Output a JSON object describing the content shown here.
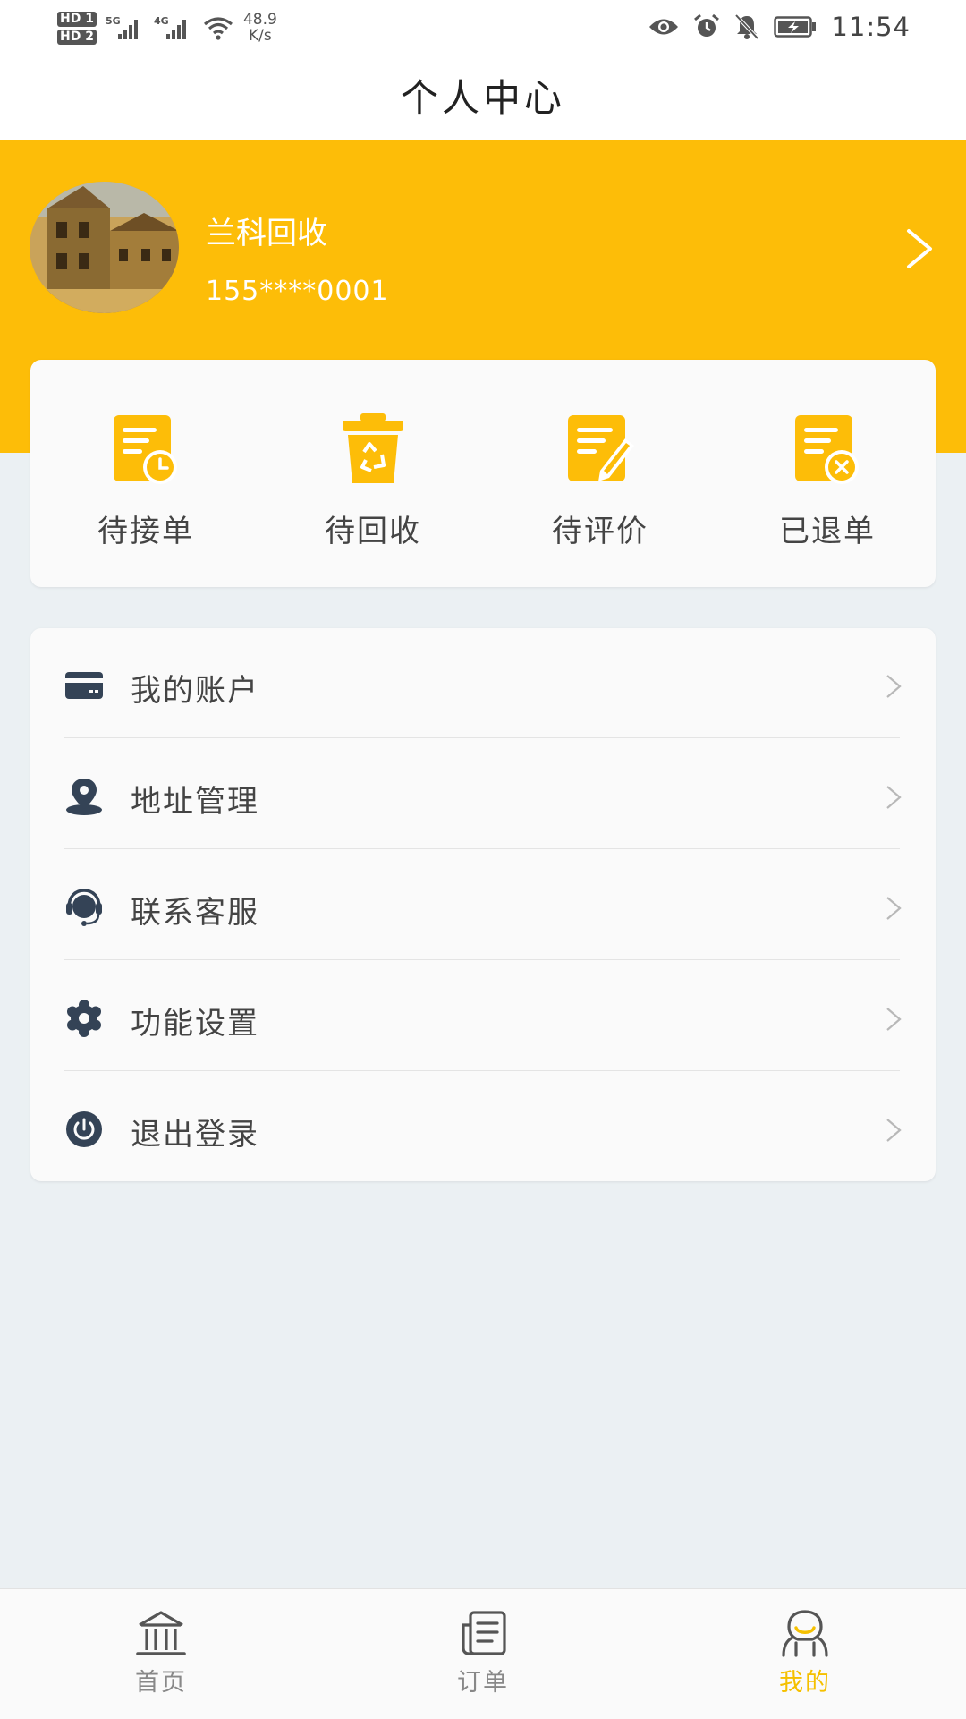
{
  "status_bar": {
    "sim1": "HD 1",
    "sim2": "HD 2",
    "sig1": "5G",
    "sig2": "4G",
    "net_speed_value": "48.9",
    "net_speed_unit": "K/s",
    "time": "11:54"
  },
  "header": {
    "title": "个人中心"
  },
  "profile": {
    "name": "兰科回收",
    "phone": "155****0001"
  },
  "orders": {
    "items": [
      {
        "label": "待接单",
        "icon": "order-pending-clock-icon"
      },
      {
        "label": "待回收",
        "icon": "recycle-bin-icon"
      },
      {
        "label": "待评价",
        "icon": "review-edit-icon"
      },
      {
        "label": "已退单",
        "icon": "order-cancelled-icon"
      }
    ]
  },
  "menu": {
    "items": [
      {
        "label": "我的账户",
        "icon": "card-icon"
      },
      {
        "label": "地址管理",
        "icon": "location-pin-icon"
      },
      {
        "label": "联系客服",
        "icon": "headset-icon"
      },
      {
        "label": "功能设置",
        "icon": "gear-icon"
      },
      {
        "label": "退出登录",
        "icon": "power-icon"
      }
    ]
  },
  "tabbar": {
    "items": [
      {
        "label": "首页",
        "icon": "home-bank-icon",
        "active": false
      },
      {
        "label": "订单",
        "icon": "order-list-icon",
        "active": false
      },
      {
        "label": "我的",
        "icon": "mine-face-icon",
        "active": true
      }
    ]
  },
  "colors": {
    "accent": "#fdbd08",
    "icon_dark": "#344356",
    "background": "#ebf0f3",
    "tab_active": "#f5c000"
  }
}
